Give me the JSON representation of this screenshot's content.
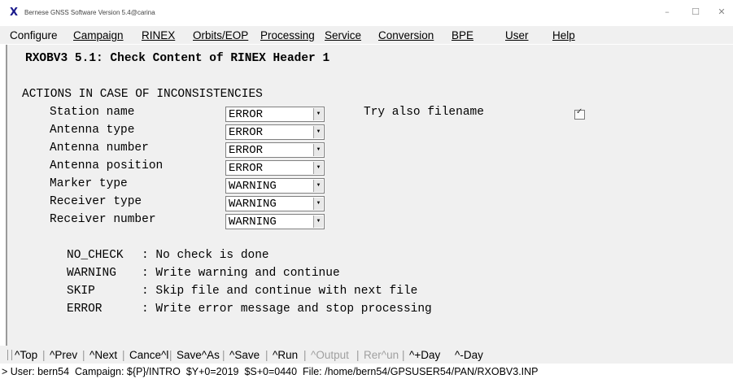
{
  "window": {
    "title": "Bernese GNSS Software Version 5.4@carina",
    "icon": "x-app-icon",
    "minimize": "–",
    "maximize": "☐",
    "close": "✕"
  },
  "menu": [
    "Configure",
    "Campaign",
    "RINEX",
    "Orbits/EOP",
    "Processing",
    "Service",
    "Conversion",
    "BPE",
    "User",
    "Help"
  ],
  "panel": {
    "title": "RXOBV3 5.1: Check Content of RINEX Header 1",
    "section": "ACTIONS IN CASE OF INCONSISTENCIES",
    "fields": [
      {
        "label": "Station name",
        "value": "ERROR"
      },
      {
        "label": "Antenna type",
        "value": "ERROR"
      },
      {
        "label": "Antenna number",
        "value": "ERROR"
      },
      {
        "label": "Antenna position",
        "value": "ERROR"
      },
      {
        "label": "Marker type",
        "value": "WARNING"
      },
      {
        "label": "Receiver type",
        "value": "WARNING"
      },
      {
        "label": "Receiver number",
        "value": "WARNING"
      }
    ],
    "try_filename_label": "Try also filename",
    "try_filename_checked": true,
    "help": [
      {
        "key": "NO_CHECK",
        "desc": ": No check is done"
      },
      {
        "key": "WARNING",
        "desc": ": Write warning and continue"
      },
      {
        "key": "SKIP",
        "desc": ": Skip file and continue with next file"
      },
      {
        "key": "ERROR",
        "desc": ": Write error message and stop processing"
      }
    ]
  },
  "toolbar": {
    "buttons": [
      {
        "label": "^Top",
        "enabled": true
      },
      {
        "label": "^Prev",
        "enabled": true
      },
      {
        "label": "^Next",
        "enabled": true
      },
      {
        "label": "Cance^l",
        "enabled": true
      },
      {
        "label": "Save^As",
        "enabled": true
      },
      {
        "label": "^Save",
        "enabled": true
      },
      {
        "label": "^Run",
        "enabled": true
      },
      {
        "label": "^Output",
        "enabled": false
      },
      {
        "label": "Rer^un",
        "enabled": false
      },
      {
        "label": "^+Day",
        "enabled": true
      },
      {
        "label": "^-Day",
        "enabled": true
      }
    ]
  },
  "status": "> User: bern54  Campaign: ${P}/INTRO  $Y+0=2019  $S+0=0440  File: /home/bern54/GPSUSER54/PAN/RXOBV3.INP"
}
